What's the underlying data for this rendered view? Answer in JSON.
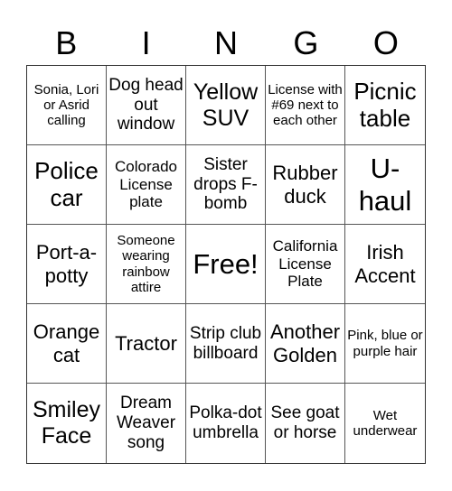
{
  "header": [
    "B",
    "I",
    "N",
    "G",
    "O"
  ],
  "cells": [
    {
      "text": "Sonia, Lori or Asrid calling",
      "size": "s15"
    },
    {
      "text": "Dog head out window",
      "size": "s19"
    },
    {
      "text": "Yellow SUV",
      "size": "s24"
    },
    {
      "text": "License with #69 next to each other",
      "size": "s15"
    },
    {
      "text": "Picnic table",
      "size": "s26"
    },
    {
      "text": "Police car",
      "size": "s26"
    },
    {
      "text": "Colorado License plate",
      "size": "s17"
    },
    {
      "text": "Sister drops F-bomb",
      "size": "s19"
    },
    {
      "text": "Rubber duck",
      "size": "s22"
    },
    {
      "text": "U-haul",
      "size": "s30"
    },
    {
      "text": "Port-a-potty",
      "size": "s22"
    },
    {
      "text": "Someone wearing rainbow attire",
      "size": "s15"
    },
    {
      "text": "Free!",
      "size": "s30"
    },
    {
      "text": "California License Plate",
      "size": "s17"
    },
    {
      "text": "Irish Accent",
      "size": "s22"
    },
    {
      "text": "Orange cat",
      "size": "s22"
    },
    {
      "text": "Tractor",
      "size": "s22"
    },
    {
      "text": "Strip club billboard",
      "size": "s19"
    },
    {
      "text": "Another Golden",
      "size": "s22"
    },
    {
      "text": "Pink, blue or purple hair",
      "size": "s15"
    },
    {
      "text": "Smiley Face",
      "size": "s24"
    },
    {
      "text": "Dream Weaver song",
      "size": "s19"
    },
    {
      "text": "Polka-dot umbrella",
      "size": "s19"
    },
    {
      "text": "See goat or horse",
      "size": "s19"
    },
    {
      "text": "Wet underwear",
      "size": "s15"
    }
  ]
}
